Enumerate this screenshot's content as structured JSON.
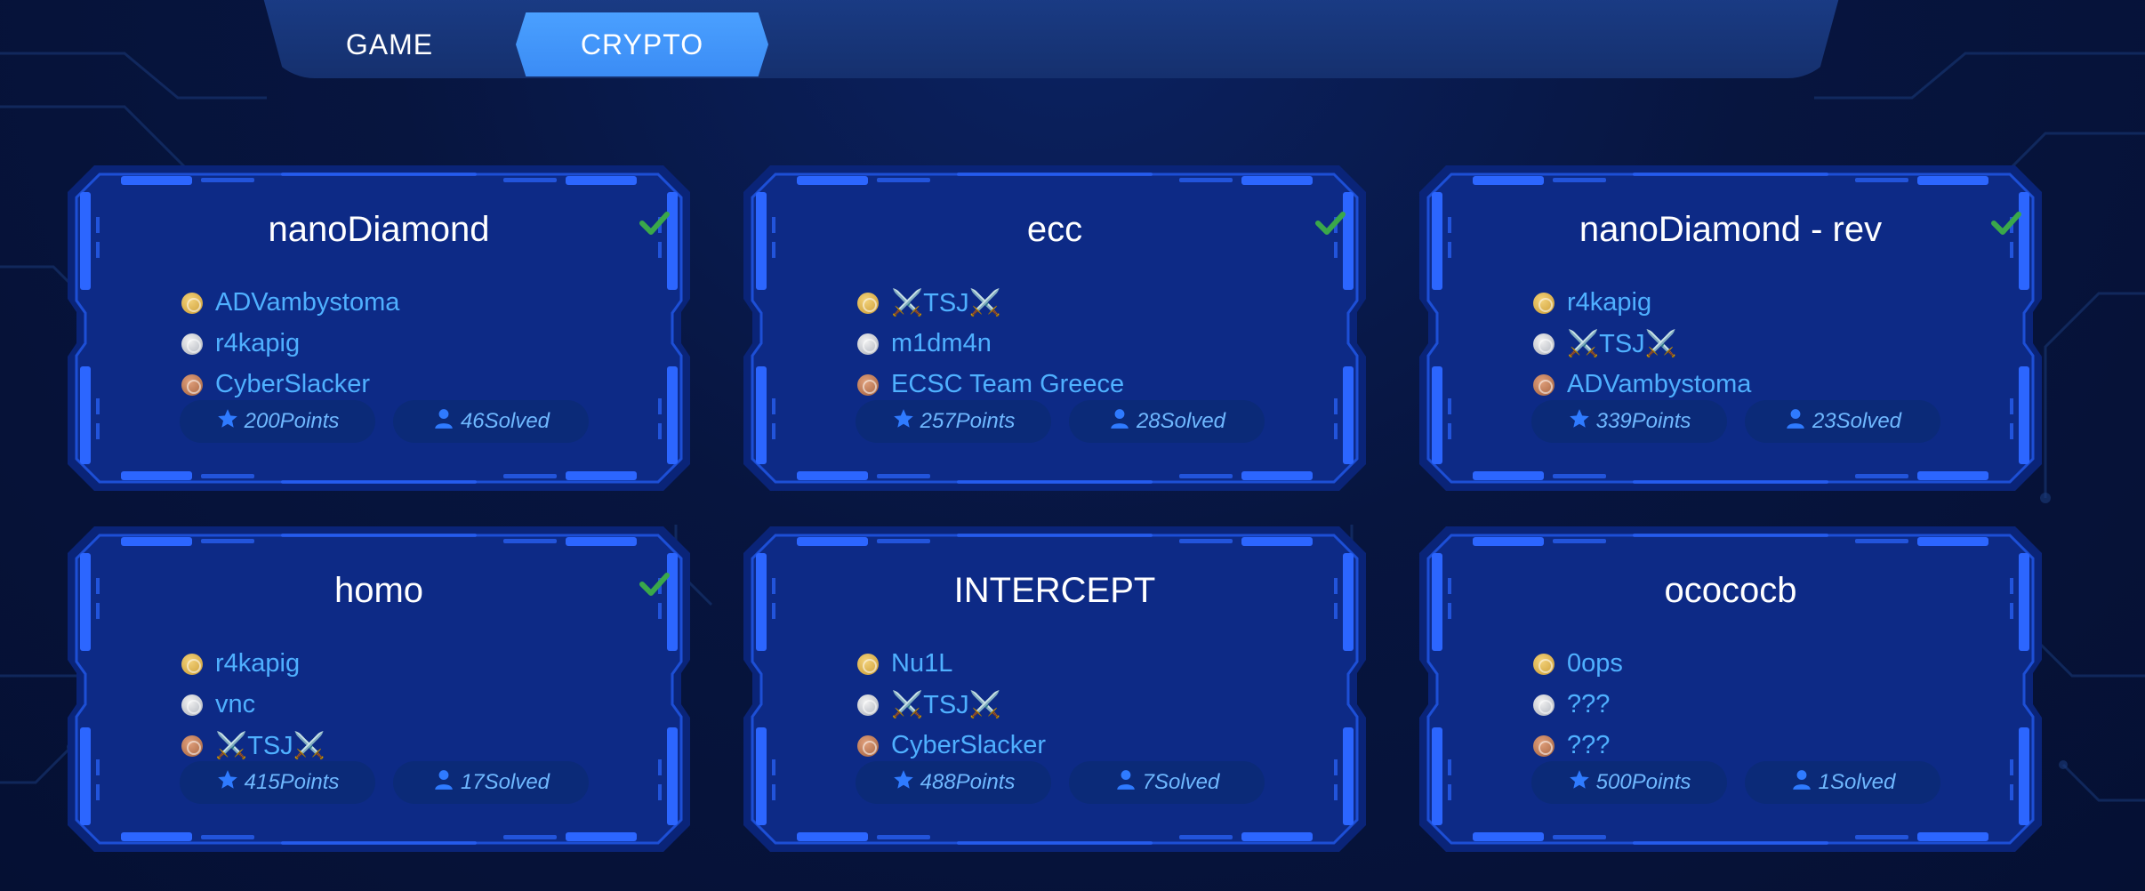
{
  "tabs": [
    {
      "label": "GAME",
      "active": false
    },
    {
      "label": "CRYPTO",
      "active": true
    }
  ],
  "colors": {
    "background": "#06123a",
    "card": "#0d2a86",
    "accent": "#2c66ff",
    "active_tab": "#4aa0ff",
    "check": "#3aa84a",
    "player_name": "#4fb0ff"
  },
  "icons": {
    "points": "star-icon",
    "solved": "user-icon",
    "completed": "checkmark-icon",
    "medals": [
      "gold-medal-icon",
      "silver-medal-icon",
      "bronze-medal-icon"
    ]
  },
  "challenges": [
    {
      "name": "nanoDiamond",
      "completed": true,
      "top": [
        "ADVambystoma",
        "r4kapig",
        "CyberSlacker"
      ],
      "points": "200Points",
      "solved": "46Solved"
    },
    {
      "name": "ecc",
      "completed": true,
      "top": [
        "⚔️TSJ⚔️",
        "m1dm4n",
        "ECSC Team Greece"
      ],
      "points": "257Points",
      "solved": "28Solved"
    },
    {
      "name": "nanoDiamond - rev",
      "completed": true,
      "top": [
        "r4kapig",
        "⚔️TSJ⚔️",
        "ADVambystoma"
      ],
      "points": "339Points",
      "solved": "23Solved"
    },
    {
      "name": "homo",
      "completed": true,
      "top": [
        "r4kapig",
        "vnc",
        "⚔️TSJ⚔️"
      ],
      "points": "415Points",
      "solved": "17Solved"
    },
    {
      "name": "INTERCEPT",
      "completed": false,
      "top": [
        "Nu1L",
        "⚔️TSJ⚔️",
        "CyberSlacker"
      ],
      "points": "488Points",
      "solved": "7Solved"
    },
    {
      "name": "ocococb",
      "completed": false,
      "top": [
        "0ops",
        "???",
        "???"
      ],
      "points": "500Points",
      "solved": "1Solved"
    }
  ]
}
